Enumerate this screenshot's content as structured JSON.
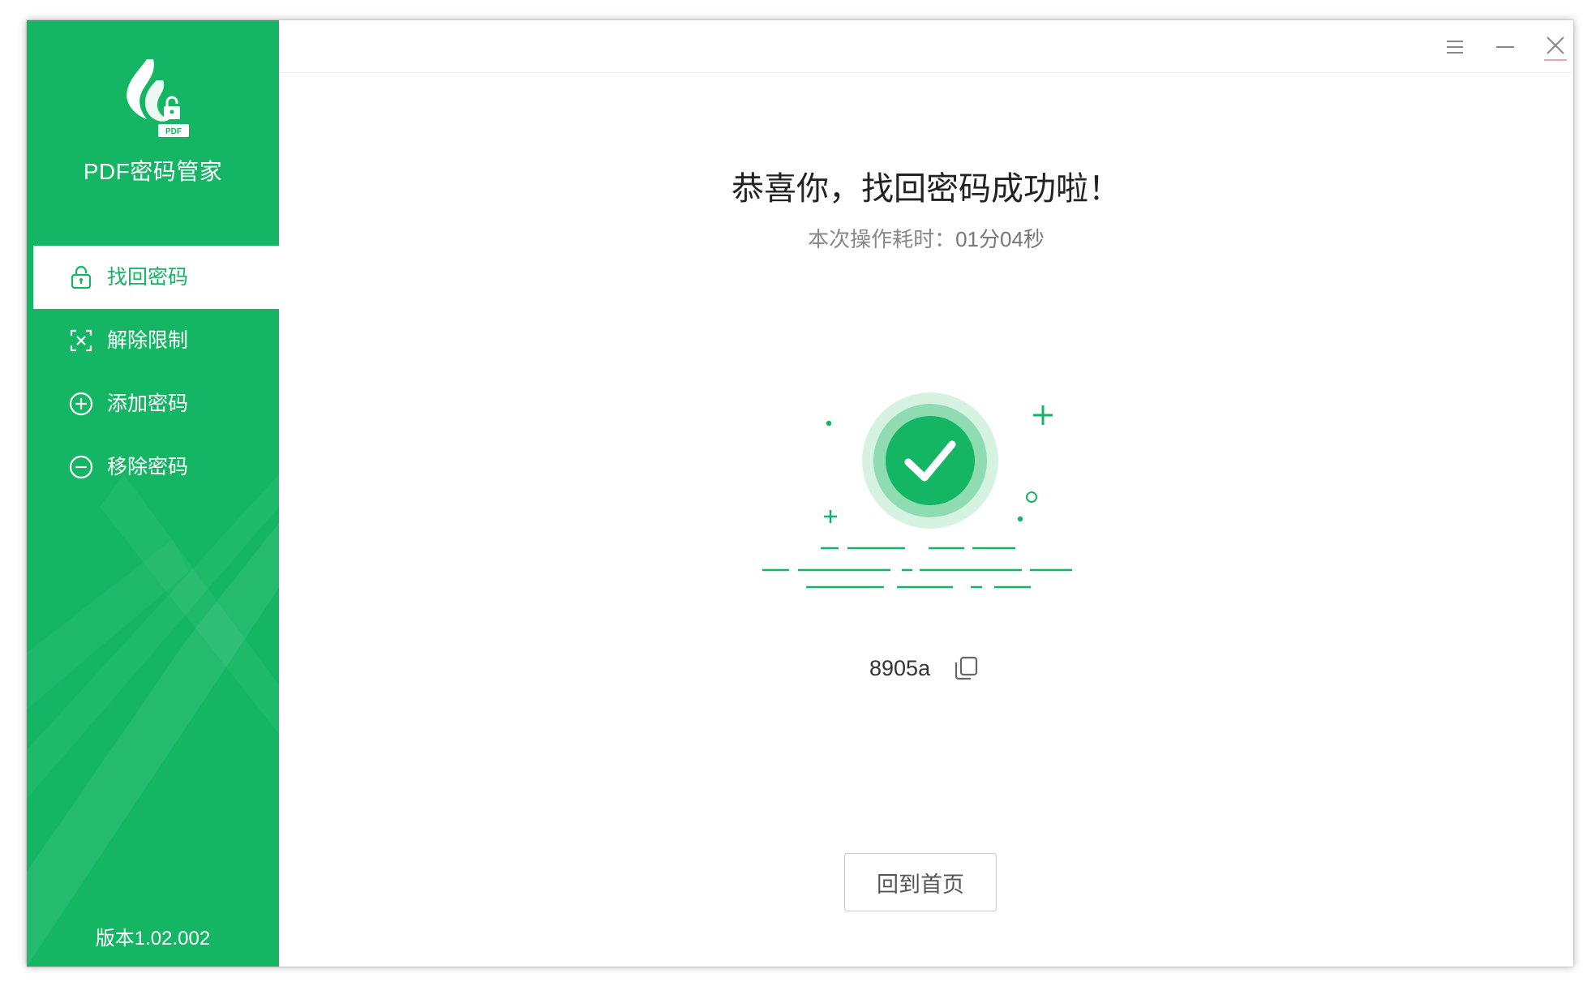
{
  "app": {
    "name": "PDF密码管家",
    "version": "版本1.02.002",
    "logo_badge": "PDF",
    "brand_color": "#14b663"
  },
  "sidebar": {
    "items": [
      {
        "label": "找回密码",
        "icon": "unlock-padlock-icon",
        "active": true
      },
      {
        "label": "解除限制",
        "icon": "scan-remove-icon",
        "active": false
      },
      {
        "label": "添加密码",
        "icon": "plus-circle-icon",
        "active": false
      },
      {
        "label": "移除密码",
        "icon": "minus-circle-icon",
        "active": false
      }
    ]
  },
  "titlebar": {
    "buttons": [
      "menu-icon",
      "minimize-icon",
      "close-icon"
    ]
  },
  "result": {
    "headline": "恭喜你，找回密码成功啦！",
    "duration_label": "本次操作耗时：",
    "duration_value": "01分04秒",
    "password": "8905a",
    "copy_icon": "copy-icon",
    "success_icon": "check-circle-icon"
  },
  "actions": {
    "home_button": "回到首页"
  }
}
